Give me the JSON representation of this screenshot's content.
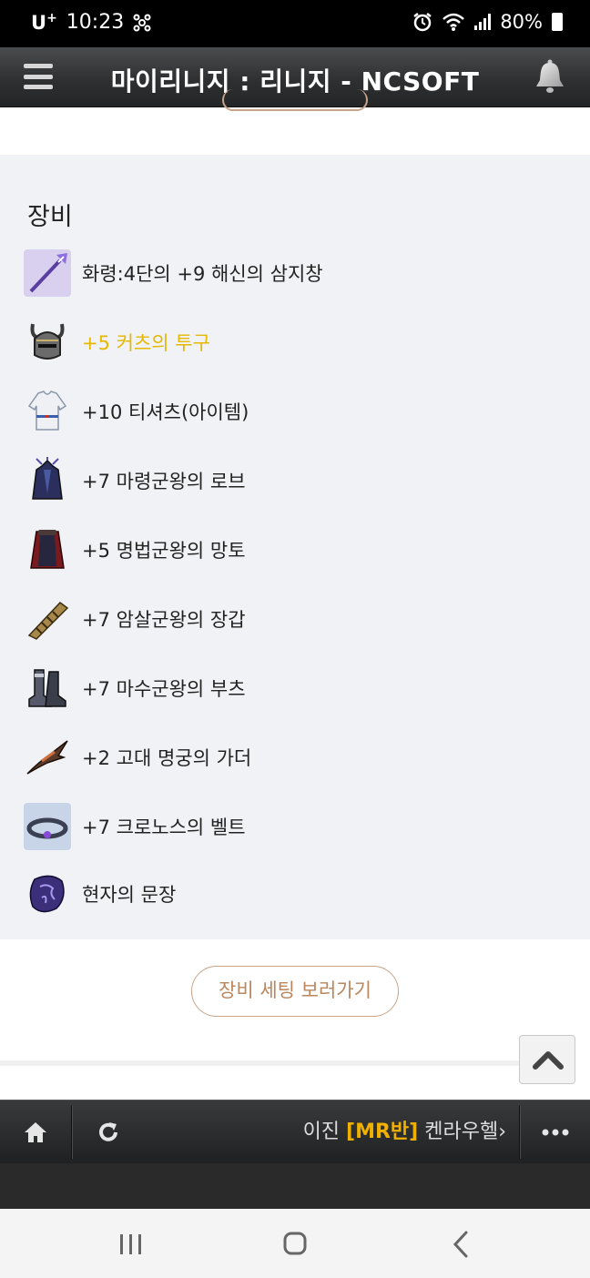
{
  "status_bar": {
    "carrier": "U",
    "carrier_sup": "+",
    "time": "10:23",
    "battery": "80%"
  },
  "header": {
    "title": "마이리니지 : 리니지 - NCSOFT"
  },
  "equipment": {
    "heading": "장비",
    "items": [
      {
        "name": "화령:4단의 +9 해신의 삼지창",
        "icon": "trident-icon",
        "highlight": false
      },
      {
        "name": "+5 커츠의 투구",
        "icon": "helmet-icon",
        "highlight": true
      },
      {
        "name": "+10 티셔츠(아이템)",
        "icon": "tshirt-icon",
        "highlight": false
      },
      {
        "name": "+7 마령군왕의 로브",
        "icon": "robe-icon",
        "highlight": false
      },
      {
        "name": "+5 명법군왕의 망토",
        "icon": "cloak-icon",
        "highlight": false
      },
      {
        "name": "+7 암살군왕의 장갑",
        "icon": "gloves-icon",
        "highlight": false
      },
      {
        "name": "+7 마수군왕의 부츠",
        "icon": "boots-icon",
        "highlight": false
      },
      {
        "name": "+2 고대 명궁의 가더",
        "icon": "guarder-icon",
        "highlight": false
      },
      {
        "name": "+7 크로노스의 벨트",
        "icon": "belt-icon",
        "highlight": false
      },
      {
        "name": "현자의 문장",
        "icon": "emblem-icon",
        "highlight": false
      }
    ],
    "highlight_color": "#e6b800"
  },
  "actions": {
    "settings_button": "장비 세팅 보러가기"
  },
  "bottom_nav": {
    "marquee_prefix": "이진 ",
    "marquee_tag": "[MR반]",
    "marquee_suffix": " 켄라우헬›"
  }
}
